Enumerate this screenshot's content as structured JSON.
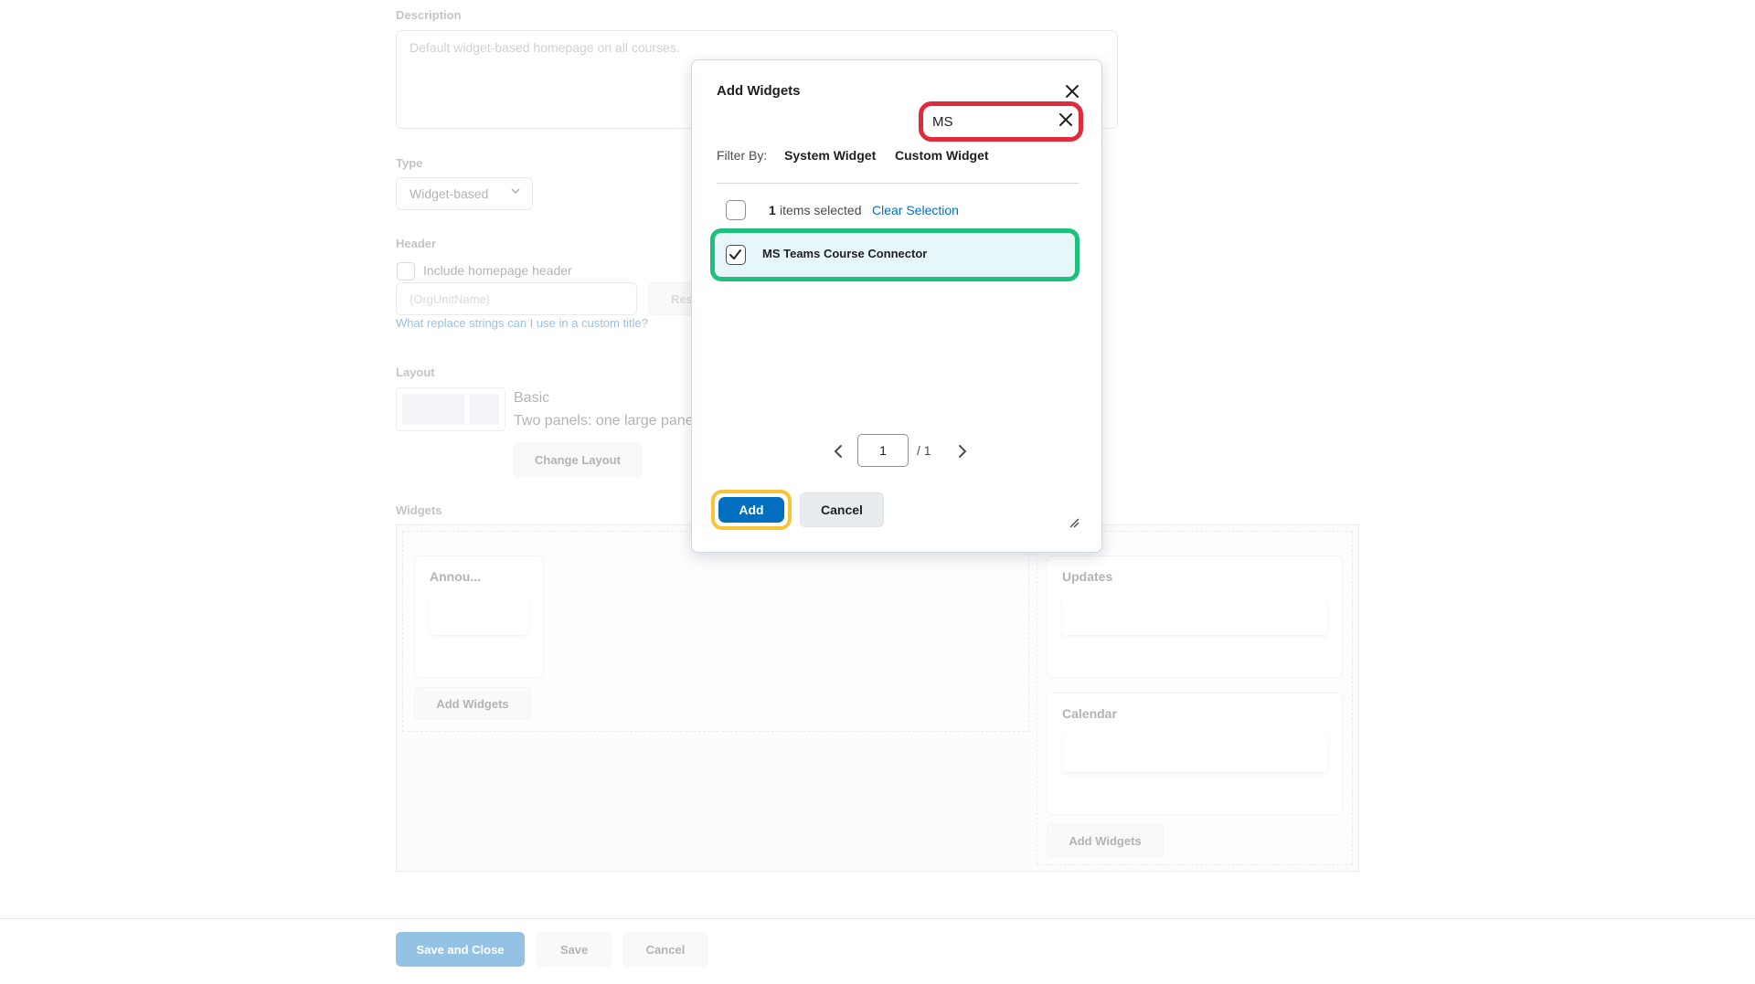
{
  "background": {
    "description_label": "Description",
    "description_placeholder": "Default widget-based homepage on all courses.",
    "type_label": "Type",
    "type_value": "Widget-based",
    "header_label": "Header",
    "include_header_label": "Include homepage header",
    "title_placeholder": "{OrgUnitName}",
    "reset_partial": "Res",
    "replace_strings_link": "What replace strings can I use in a custom title?",
    "layout_label": "Layout",
    "layout_name": "Basic",
    "layout_desc": "Two panels: one large panel",
    "change_layout": "Change Layout",
    "widgets_label": "Widgets",
    "widget_announcements": "Annou...",
    "add_widgets_left": "Add Widgets",
    "widget_updates": "Updates",
    "widget_calendar": "Calendar",
    "add_widgets_right": "Add Widgets"
  },
  "footer": {
    "save_and_close": "Save and Close",
    "save": "Save",
    "cancel": "Cancel"
  },
  "dialog": {
    "title": "Add Widgets",
    "search_value": "MS",
    "filter_by": "Filter By:",
    "filter_system": "System Widget",
    "filter_custom": "Custom Widget",
    "selected_count": "1",
    "selected_text": "items selected",
    "clear_selection": "Clear Selection",
    "item_name": "MS Teams Course Connector",
    "page_current": "1",
    "page_total": "/ 1",
    "add": "Add",
    "cancel": "Cancel"
  },
  "colors": {
    "primary": "#006fbf",
    "highlight_search": "#e02b3b",
    "highlight_item": "#1ec07c",
    "highlight_add": "#f6c53a"
  },
  "icons": {
    "close": "close-icon",
    "clear_search": "clear-search-icon",
    "checkmark": "checkmark-icon",
    "chevron_left": "chevron-left-icon",
    "chevron_right": "chevron-right-icon",
    "chevron_down": "chevron-down-icon",
    "resize": "resize-handle-icon"
  }
}
